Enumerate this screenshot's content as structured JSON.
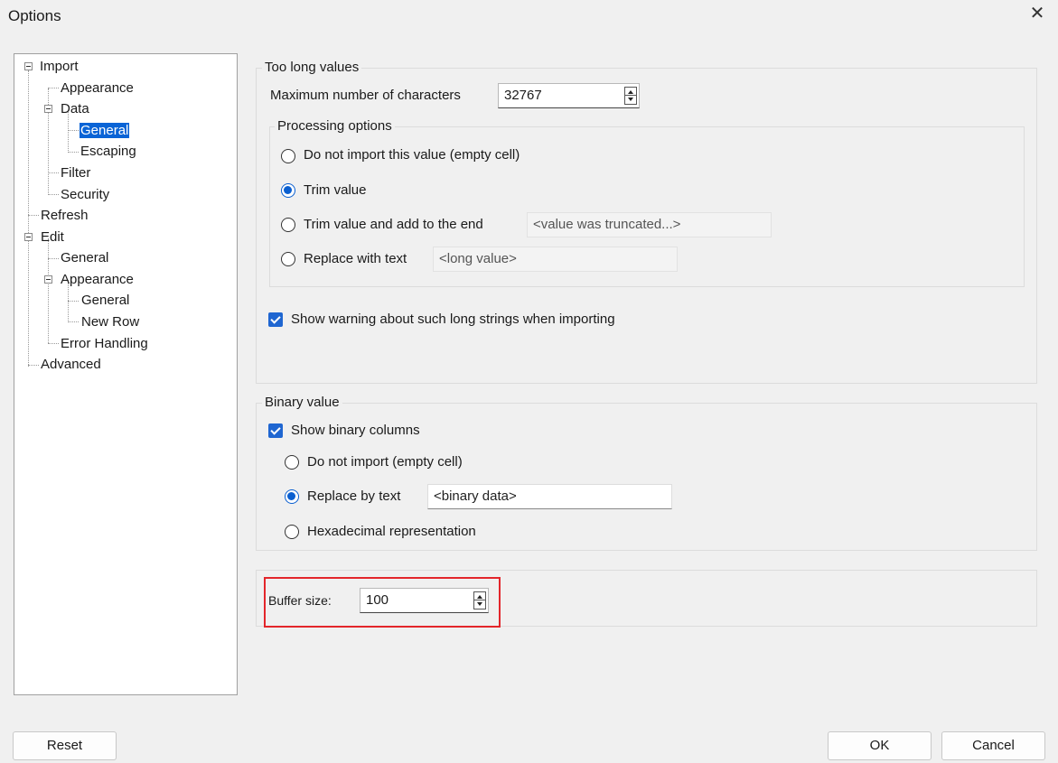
{
  "window": {
    "title": "Options",
    "close_glyph": "✕"
  },
  "tree": {
    "import": "Import",
    "appearance": "Appearance",
    "data": "Data",
    "general": "General",
    "escaping": "Escaping",
    "filter": "Filter",
    "security": "Security",
    "refresh": "Refresh",
    "edit": "Edit",
    "edit_general": "General",
    "edit_appearance": "Appearance",
    "edit_app_general": "General",
    "edit_app_newrow": "New Row",
    "error_handling": "Error Handling",
    "advanced": "Advanced",
    "selected": "General"
  },
  "too_long": {
    "legend": "Too long values",
    "max_label": "Maximum number of characters",
    "max_value": "32767",
    "processing_legend": "Processing options",
    "opt1": "Do not import this value (empty cell)",
    "opt2": "Trim value",
    "opt3": "Trim value and add to the end",
    "opt3_value": "<value was truncated...>",
    "opt4": "Replace with text",
    "opt4_value": "<long value>",
    "selected_option": "Trim value",
    "warning_label": "Show warning about such long strings when importing",
    "warning_checked": true
  },
  "binary": {
    "legend": "Binary value",
    "show_label": "Show binary columns",
    "show_checked": true,
    "opt1": "Do not import (empty cell)",
    "opt2": "Replace by text",
    "opt2_value": "<binary data>",
    "opt3": "Hexadecimal representation",
    "selected_option": "Replace by text"
  },
  "buffer": {
    "label": "Buffer size:",
    "value": "100"
  },
  "buttons": {
    "reset": "Reset",
    "ok": "OK",
    "cancel": "Cancel"
  },
  "colors": {
    "accent": "#0a64d6",
    "highlight": "#e3262b"
  }
}
